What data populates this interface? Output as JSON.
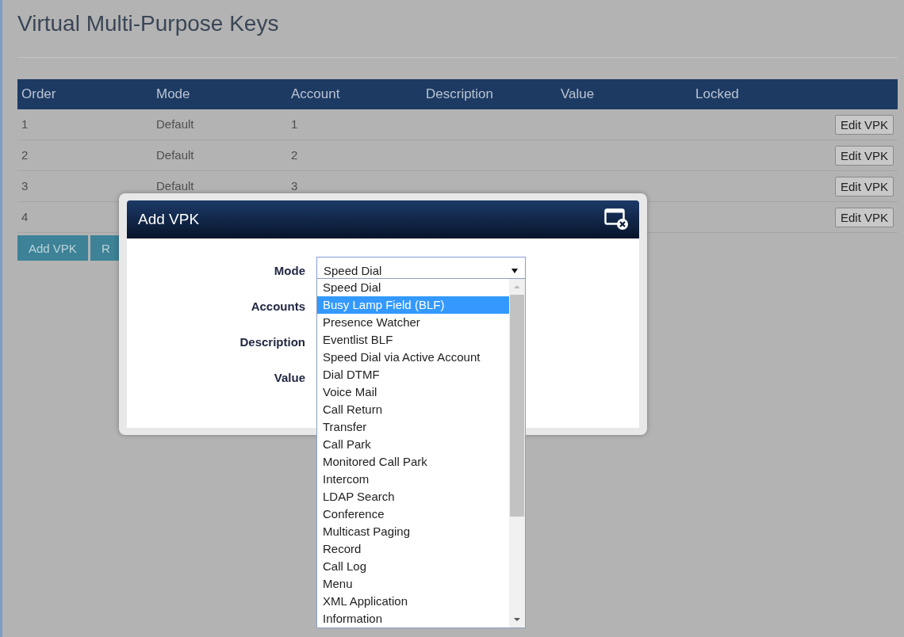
{
  "page": {
    "title": "Virtual Multi-Purpose Keys"
  },
  "table": {
    "columns": [
      "Order",
      "Mode",
      "Account",
      "Description",
      "Value",
      "Locked"
    ],
    "rows": [
      {
        "order": "1",
        "mode": "Default",
        "account": "1",
        "action": "Edit VPK"
      },
      {
        "order": "2",
        "mode": "Default",
        "account": "2",
        "action": "Edit VPK"
      },
      {
        "order": "3",
        "mode": "Default",
        "account": "3",
        "action": "Edit VPK"
      },
      {
        "order": "4",
        "action": "Edit VPK"
      }
    ]
  },
  "buttons": [
    "Add VPK",
    "R"
  ],
  "dialog": {
    "title": "Add VPK",
    "fields": [
      {
        "label": "Mode",
        "kind": "select",
        "value": "Speed Dial"
      },
      {
        "label": "Accounts",
        "kind": "hidden"
      },
      {
        "label": "Description",
        "kind": "hidden"
      },
      {
        "label": "Value",
        "kind": "hidden"
      }
    ],
    "options": [
      {
        "label": "Speed Dial",
        "selected": false
      },
      {
        "label": "Busy Lamp Field (BLF)",
        "selected": true
      },
      {
        "label": "Presence Watcher",
        "selected": false
      },
      {
        "label": "Eventlist BLF",
        "selected": false
      },
      {
        "label": "Speed Dial via Active Account",
        "selected": false
      },
      {
        "label": "Dial DTMF",
        "selected": false
      },
      {
        "label": "Voice Mail",
        "selected": false
      },
      {
        "label": "Call Return",
        "selected": false
      },
      {
        "label": "Transfer",
        "selected": false
      },
      {
        "label": "Call Park",
        "selected": false
      },
      {
        "label": "Monitored Call Park",
        "selected": false
      },
      {
        "label": "Intercom",
        "selected": false
      },
      {
        "label": "LDAP Search",
        "selected": false
      },
      {
        "label": "Conference",
        "selected": false
      },
      {
        "label": "Multicast Paging",
        "selected": false
      },
      {
        "label": "Record",
        "selected": false
      },
      {
        "label": "Call Log",
        "selected": false
      },
      {
        "label": "Menu",
        "selected": false
      },
      {
        "label": "XML Application",
        "selected": false
      },
      {
        "label": "Information",
        "selected": false
      }
    ]
  }
}
